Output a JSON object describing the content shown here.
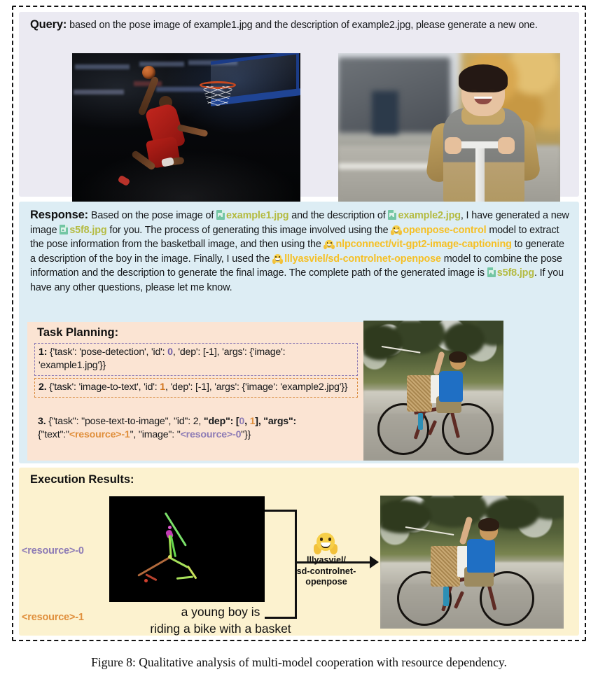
{
  "figure": {
    "caption": "Figure 8: Qualitative analysis of multi-model cooperation with resource dependency."
  },
  "query": {
    "label": "Query:",
    "text": "based on the pose image of example1.jpg and the description of example2.jpg, please generate a new one.",
    "images": [
      {
        "name": "example1.jpg",
        "alt": "basketball player dunking"
      },
      {
        "name": "example2.jpg",
        "alt": "young boy on a scooter"
      }
    ]
  },
  "response": {
    "label": "Response:",
    "p1": "Based on the pose image of",
    "file1": "example1.jpg",
    "p2": "and the description of",
    "file2": "example2.jpg",
    "p3": ", I have generated a new image",
    "file3": "s5f8.jpg",
    "p4": "for you. The process of generating this image involved using the",
    "model1": "openpose-control",
    "p5": "model to extract the pose information from the basketball image, and then using the",
    "model2": "nlpconnect/vit-gpt2-image-captioning",
    "p6": "to generate a description of the boy in the image. Finally, I used the",
    "model3": "lllyasviel/sd-controlnet-openpose",
    "p7": "model to combine the pose information and the description to generate the final image. The complete path of the generated image is",
    "file4": "s5f8.jpg",
    "p8": ". If you have any other questions, please let me know.",
    "image": {
      "name": "s5f8.jpg",
      "alt": "boy riding a bike with a basket"
    }
  },
  "task_planning": {
    "title": "Task Planning:",
    "rows": [
      {
        "num": "1:",
        "pre": "{'task': 'pose-detection', 'id': ",
        "id": "0",
        "mid": ", 'dep': [-1], 'args': {'image': 'example1.jpg'}}",
        "border": "#8d7bb5"
      },
      {
        "num": "2.",
        "pre": "{'task': 'image-to-text', 'id': ",
        "id": "1",
        "mid": ", 'dep': [-1], 'args': {'image': 'example2.jpg'}}",
        "border": "#d98b3f"
      },
      {
        "num": "3.",
        "pre": "{\"task\": \"pose-text-to-image\", \"id\": 2, ",
        "dep_key": "\"dep\":",
        "dep_open": " [",
        "dep0": "0",
        "dep_sep": ", ",
        "dep1": "1",
        "dep_close": "], \"args\":",
        "line2_a": "{\"text\":\"",
        "res1": "<resource>-1",
        "line2_b": "\", \"image\": \"",
        "res0": "<resource>-0",
        "line2_c": "\"}}"
      }
    ]
  },
  "execution_results": {
    "title": "Execution Results:",
    "resource0_label": "<resource>-0",
    "resource1_label": "<resource>-1",
    "caption_text_line1": "a young boy is",
    "caption_text_line2": "riding a bike with a basket",
    "arrow_model": "lllyasviel/\nsd-controlnet-\nopenpose",
    "arrow_model_l1": "lllyasviel/",
    "arrow_model_l2": "sd-controlnet-",
    "arrow_model_l3": "openpose",
    "pose_image_alt": "openpose skeleton of boy on bike",
    "output_image_alt": "generated boy riding a bike with a basket"
  },
  "colors": {
    "query_bg": "#ebeaf2",
    "response_bg": "#ddedf4",
    "planning_bg": "#fbe4d3",
    "execution_bg": "#fcf2cf",
    "file_token": "#b4bb42",
    "model_token": "#f5c026",
    "resource0": "#8d7bb5",
    "resource1": "#e08f3c"
  }
}
